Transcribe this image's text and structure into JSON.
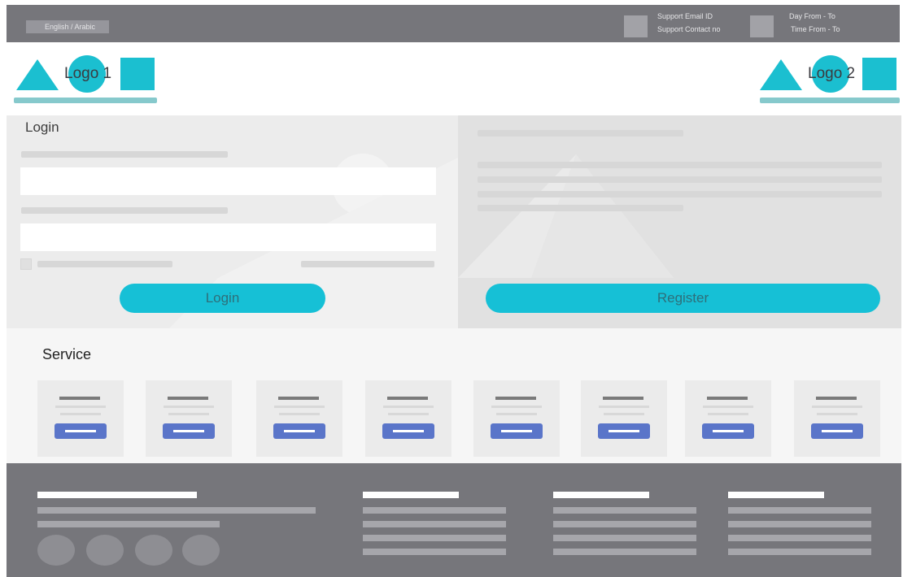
{
  "topbar": {
    "language_label": "English / Arabic",
    "support_email_label": "Support Email ID",
    "support_contact_label": "Support Contact no",
    "day_label": "Day From - To",
    "time_label": "Time From - To"
  },
  "header": {
    "logo1": "Logo 1",
    "logo2": "Logo 2"
  },
  "login": {
    "title": "Login",
    "login_button": "Login",
    "register_button": "Register"
  },
  "services": {
    "title": "Service",
    "card_count_note": ""
  },
  "colors": {
    "accent": "#16c0d6",
    "topbar": "#76767b",
    "card_button": "#5a75c9",
    "footer": "#76767b"
  }
}
